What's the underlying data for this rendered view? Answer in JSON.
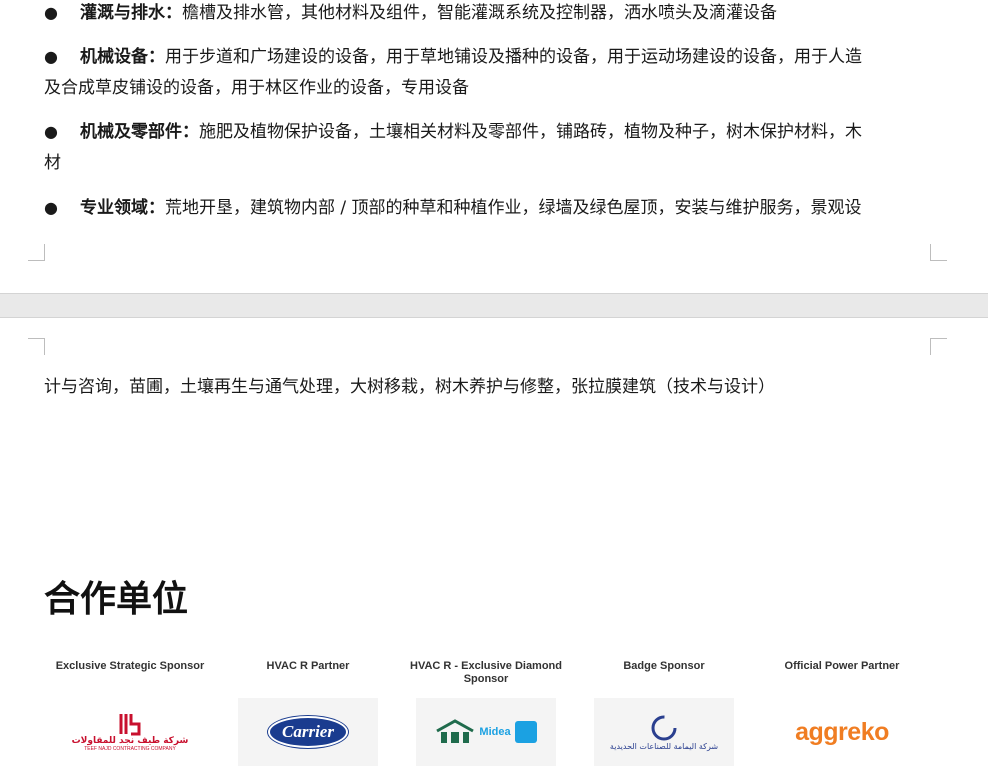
{
  "bullets": [
    {
      "term": "灌溉与排水：",
      "text": "檐槽及排水管，其他材料及组件，智能灌溉系统及控制器，洒水喷头及滴灌设备"
    },
    {
      "term": "机械设备：",
      "text": "用于步道和广场建设的设备，用于草地铺设及播种的设备，用于运动场建设的设备，用于人造",
      "text2": "及合成草皮铺设的设备，用于林区作业的设备，专用设备"
    },
    {
      "term": "机械及零部件：",
      "text": "施肥及植物保护设备，土壤相关材料及零部件，铺路砖，植物及种子，树木保护材料，木",
      "text2": "材"
    },
    {
      "term": "专业领域：",
      "text": "荒地开垦，建筑物内部 / 顶部的种草和种植作业，绿墙及绿色屋顶，安装与维护服务，景观设"
    }
  ],
  "continuation": "计与咨询，苗圃，土壤再生与通气处理，大树移栽，树木养护与修整，张拉膜建筑（技术与设计）",
  "section_title": "合作单位",
  "sponsors": [
    {
      "label": "Exclusive Strategic Sponsor",
      "logo_text": "شركة طيف نجد للمقاولات",
      "logo_sub": "TEEF NAJD CONTRACTING COMPANY",
      "icon": "teef-najd-logo"
    },
    {
      "label": "HVAC R Partner",
      "logo_text": "Carrier",
      "icon": "carrier-logo"
    },
    {
      "label": "HVAC R - Exclusive Diamond Sponsor",
      "logo_text": "Midea",
      "icon": "midea-logo"
    },
    {
      "label": "Badge Sponsor",
      "logo_text": "شركة اليمامة للصناعات الحديدية",
      "icon": "yamama-logo"
    },
    {
      "label": "Official Power Partner",
      "logo_text": "aggreko",
      "icon": "aggreko-logo"
    }
  ],
  "colors": {
    "carrier_blue": "#1a3c8f",
    "aggreko_orange": "#f07d22",
    "teef_red": "#c8102e",
    "midea_blue": "#1ba1e2"
  }
}
